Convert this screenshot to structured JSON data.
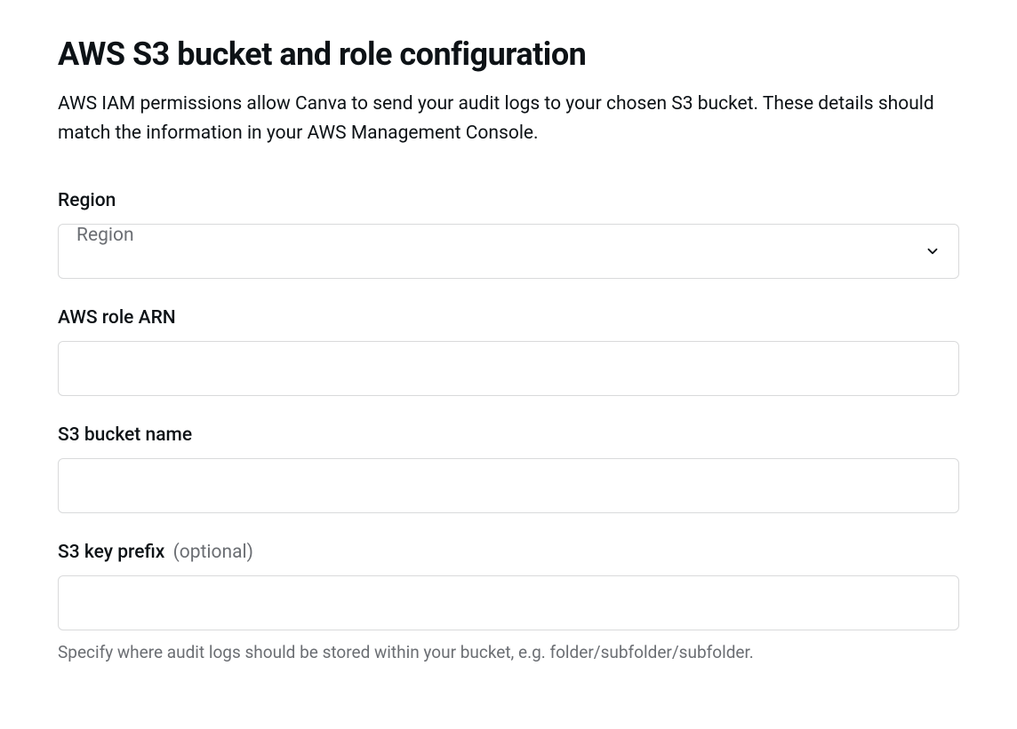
{
  "page": {
    "title": "AWS S3 bucket and role configuration",
    "description": "AWS IAM permissions allow Canva to send your audit logs to your chosen S3 bucket. These details should match the information in your AWS Management Console."
  },
  "form": {
    "region": {
      "label": "Region",
      "placeholder": "Region",
      "value": ""
    },
    "role_arn": {
      "label": "AWS role ARN",
      "value": ""
    },
    "bucket_name": {
      "label": "S3 bucket name",
      "value": ""
    },
    "key_prefix": {
      "label": "S3 key prefix",
      "optional_hint": "(optional)",
      "value": "",
      "helper": "Specify where audit logs should be stored within your bucket, e.g. folder/subfolder/subfolder."
    }
  }
}
